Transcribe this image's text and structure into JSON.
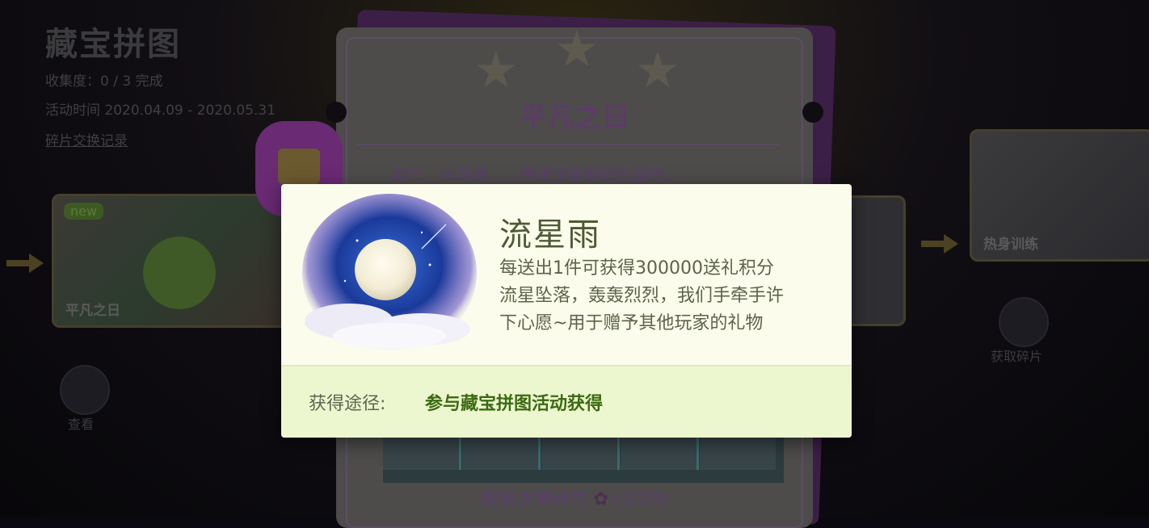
{
  "background": {
    "title": "藏宝拼图",
    "meta_lines": [
      "收集度：0 / 3 完成",
      "活动时间 2020.04.09 - 2020.05.31",
      "碎片交换记录"
    ],
    "left_card": {
      "badge": "new",
      "label": "平凡之日"
    },
    "right_card": {
      "label": "热身训练"
    },
    "bottom_texts": [
      "查看",
      "获取碎片"
    ]
  },
  "ticket": {
    "stars": [
      "star-icon",
      "star-icon",
      "star-icon"
    ],
    "title": "平凡之日",
    "description": "果汁、冰淇淋……再来张哥俩好的自拍，",
    "fragments_label": "拥有本章碎片",
    "fragments_count": "(3/20)"
  },
  "popup": {
    "item_name": "流星雨",
    "desc_lines": [
      "每送出1件可获得300000送礼积分",
      "流星坠落，轰轰烈烈，我们手牵手许",
      "下心愿~用于赠予其他玩家的礼物"
    ],
    "source_label": "获得途径:",
    "source_value": "参与藏宝拼图活动获得",
    "icon": "moon-night-sky-icon"
  },
  "colors": {
    "popup_bg": "#fbfcec",
    "footer_bg": "#edf7cf",
    "source_green": "#3b6a12"
  }
}
